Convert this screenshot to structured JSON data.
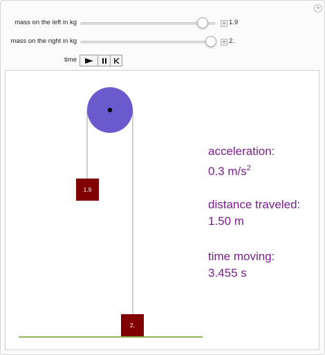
{
  "controls": {
    "left_mass": {
      "label": "mass on the left in kg",
      "value_text": "1.9",
      "slider_fraction": 0.9
    },
    "right_mass": {
      "label": "mass on the right in kg",
      "value_text": "2.",
      "slider_fraction": 0.96
    },
    "time": {
      "label": "time",
      "play_icon": "play-icon",
      "pause_icon": "pause-icon",
      "reset_icon": "reset-icon"
    }
  },
  "scene": {
    "pulley_color": "#6a5acd",
    "mass_color": "#800000",
    "ground_color": "#8db554",
    "left_mass_label": "1.9",
    "right_mass_label": "2."
  },
  "info": {
    "acceleration_label": "acceleration:",
    "acceleration_value": "0.3 m/s",
    "acceleration_exp": "2",
    "distance_label": "distance traveled:",
    "distance_value": "1.50 m",
    "time_label": "time moving:",
    "time_value": "3.455 s",
    "text_color": "#7a1f8e"
  }
}
